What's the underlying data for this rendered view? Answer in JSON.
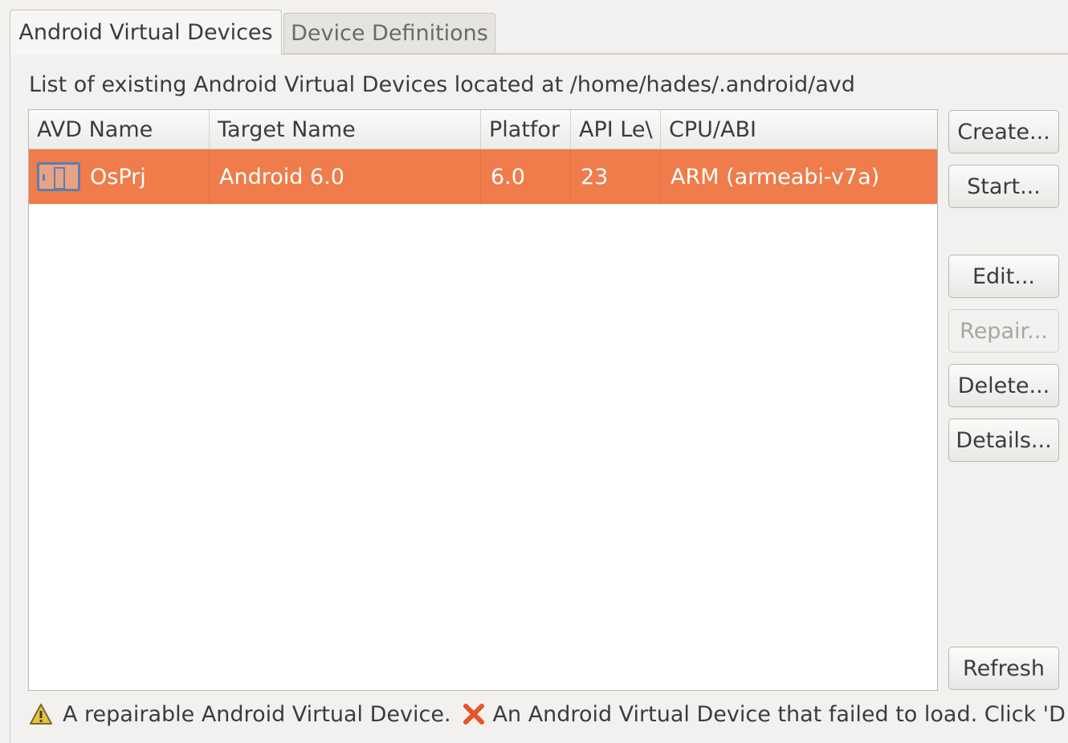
{
  "tabs": [
    {
      "label": "Android Virtual Devices",
      "active": true
    },
    {
      "label": "Device Definitions",
      "active": false
    }
  ],
  "path_label": "List of existing Android Virtual Devices located at /home/hades/.android/avd",
  "table": {
    "columns": [
      "AVD Name",
      "Target Name",
      "Platfor",
      "API Le\\",
      "CPU/ABI"
    ],
    "rows": [
      {
        "name": "OsPrj",
        "target": "Android 6.0",
        "platform": "6.0",
        "api": "23",
        "cpu": "ARM (armeabi-v7a)",
        "icon": "device-icon",
        "selected": true
      }
    ]
  },
  "buttons": {
    "create": "Create...",
    "start": "Start...",
    "edit": "Edit...",
    "repair": "Repair...",
    "delete": "Delete...",
    "details": "Details...",
    "refresh": "Refresh"
  },
  "legend": {
    "warning_icon": "warning-icon",
    "warning_text": "A repairable Android Virtual Device.",
    "error_icon": "error-x-icon",
    "error_text": "An Android Virtual Device that failed to load. Click 'De"
  },
  "colors": {
    "selection": "#ef7c4a",
    "device_icon_stroke": "#5a7fb0",
    "error_icon": "#e8542a",
    "warning_icon": "#e8c23a"
  }
}
